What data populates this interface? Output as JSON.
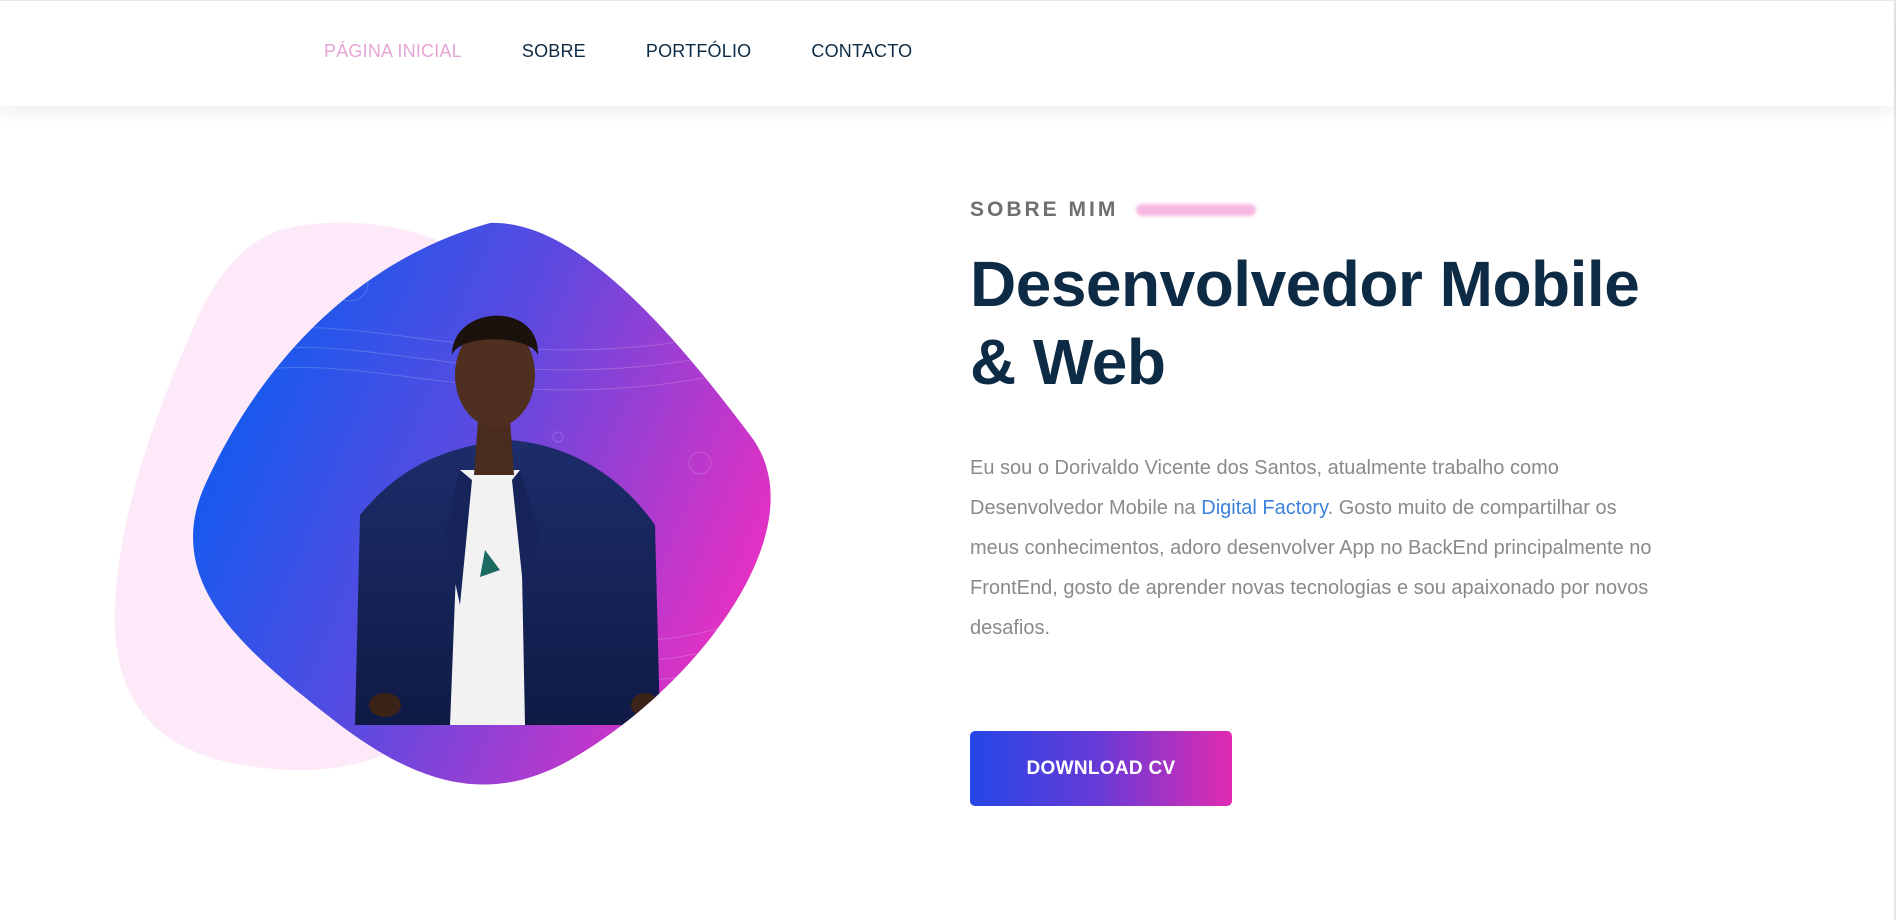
{
  "nav": {
    "items": [
      {
        "label": "PÁGINA INICIAL",
        "active": true
      },
      {
        "label": "SOBRE",
        "active": false
      },
      {
        "label": "PORTFÓLIO",
        "active": false
      },
      {
        "label": "CONTACTO",
        "active": false
      }
    ]
  },
  "hero": {
    "eyebrow": "SOBRE MIM",
    "title_line1": "Desenvolvedor Mobile",
    "title_line2": "& Web",
    "bio_part1": "Eu sou o Dorivaldo Vicente dos Santos, atualmente trabalho como Desenvolvedor Mobile na ",
    "bio_link": "Digital Factory",
    "bio_part2": ". Gosto muito de compartilhar os meus conhecimentos, adoro desenvolver App no BackEnd principalmente no FrontEnd, gosto de aprender novas tecnologias e sou apaixonado por novos desafios.",
    "cta_label": "DOWNLOAD CV"
  },
  "colors": {
    "accent_pink": "#e12bb0",
    "accent_blue": "#2446e6",
    "heading": "#0d2b45",
    "nav_active": "#e6a5d6",
    "link": "#3b82d8"
  },
  "icons": [
    "profile-photo",
    "blob-background"
  ]
}
